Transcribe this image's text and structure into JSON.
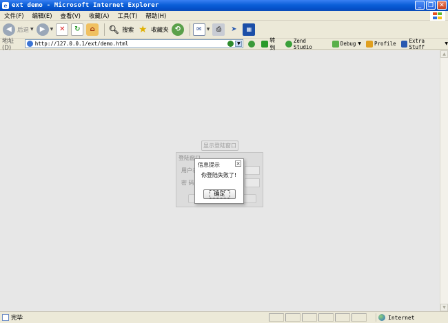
{
  "window": {
    "title": "ext demo - Microsoft Internet Explorer"
  },
  "menu": [
    "文件(F)",
    "编辑(E)",
    "查看(V)",
    "收藏(A)",
    "工具(T)",
    "帮助(H)"
  ],
  "toolbar": {
    "back_label": "后退",
    "search_label": "搜索",
    "favorites_label": "收藏夹"
  },
  "address": {
    "label": "地址(D)",
    "url": "http://127.0.0.1/ext/demo.html",
    "go_label": "转到",
    "tools": [
      "Zend Studio",
      "Debug",
      "Profile",
      "Extra Stuff"
    ]
  },
  "page": {
    "show_login_label": "显示登陆窗口",
    "login_window_title": "登陆窗口",
    "username_label": "用户名",
    "password_label": "密  码"
  },
  "message_box": {
    "title": "信息提示",
    "message": "你登陆失败了!",
    "ok_label": "确定",
    "close_glyph": "✕"
  },
  "status": {
    "text": "完毕",
    "zone": "Internet"
  }
}
